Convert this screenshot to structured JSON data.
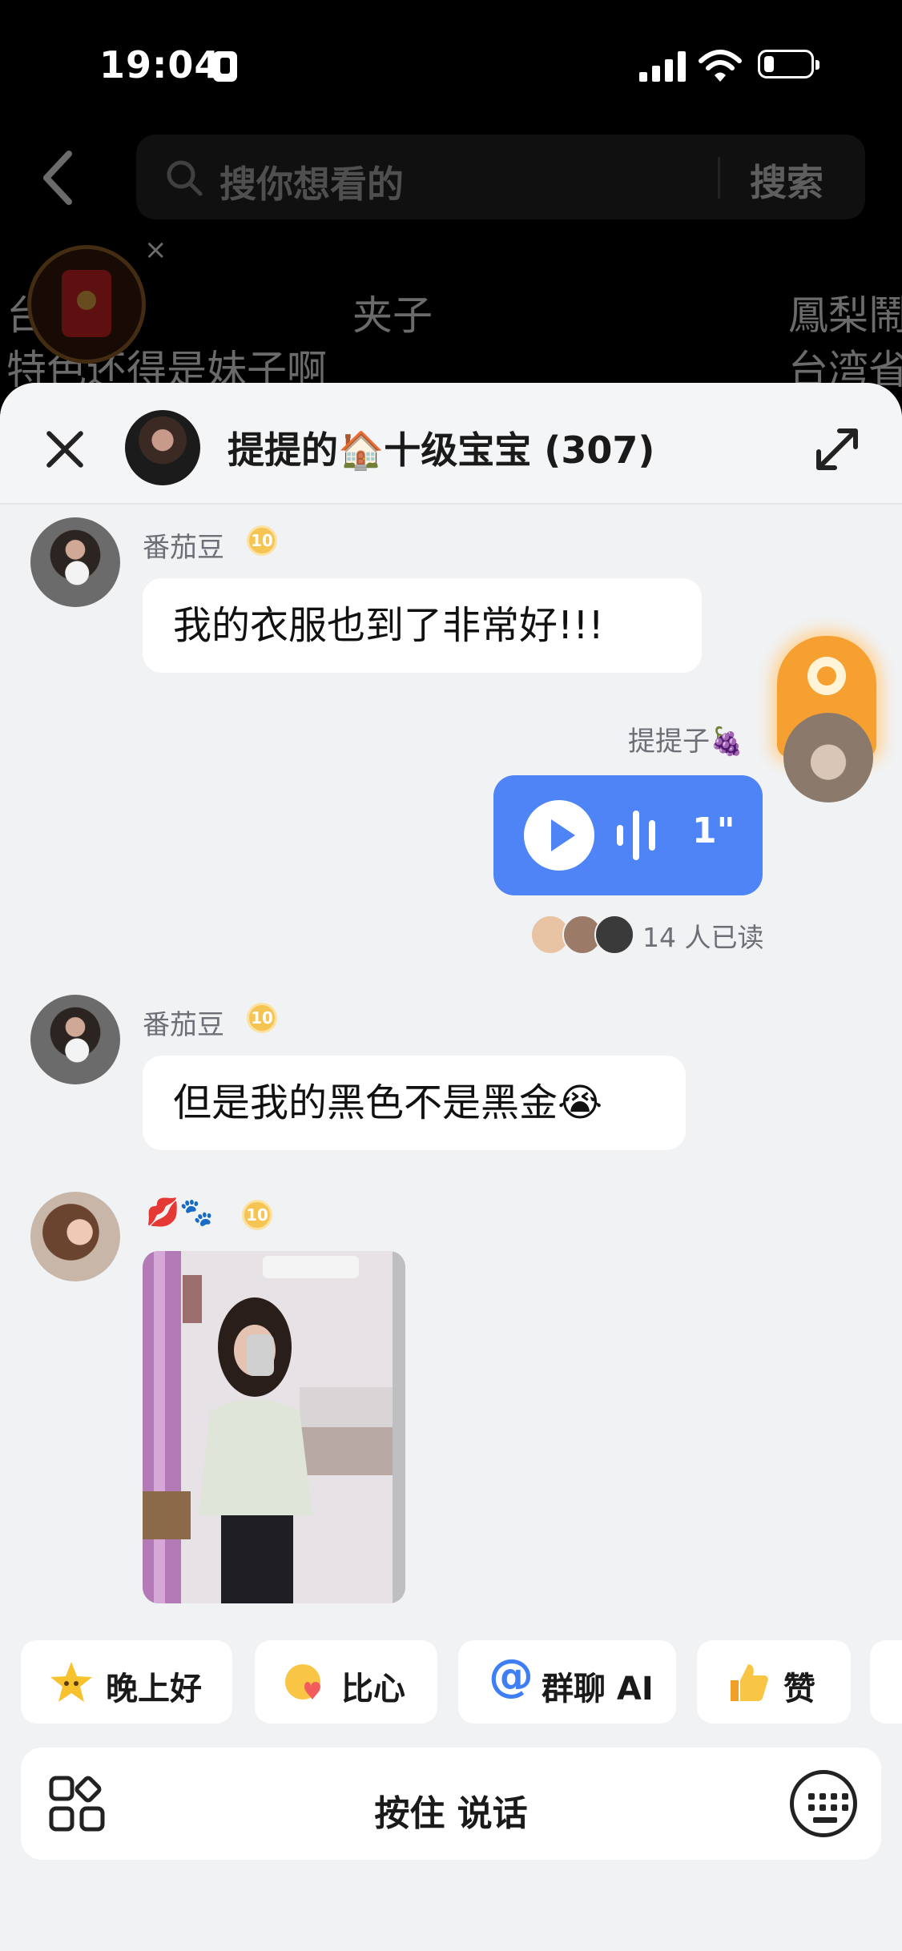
{
  "status": {
    "time": "19:04"
  },
  "background": {
    "search_placeholder": "搜你想看的",
    "search_button": "搜索",
    "topics": [
      "台…省",
      "夹子",
      "鳳梨鬧",
      "特色还得是妹子啊",
      "台湾省"
    ]
  },
  "chat": {
    "title": "提提的🏠十级宝宝 (307)",
    "messages": [
      {
        "sender": "番茄豆",
        "level": "10",
        "text": "我的衣服也到了非常好!!!"
      },
      {
        "sender": "提提子🍇",
        "voice_duration": "1\"",
        "read_count": "14 人已读"
      },
      {
        "sender": "番茄豆",
        "level": "10",
        "text": "但是我的黑色不是黑金😭"
      },
      {
        "sender": "💋🐾",
        "level": "10",
        "type": "image"
      }
    ]
  },
  "quick_replies": [
    "晚上好",
    "比心",
    "群聊 AI",
    "赞"
  ],
  "input": {
    "hold_to_talk": "按住 说话"
  },
  "icons": {
    "close": "close-icon",
    "expand": "expand-icon",
    "play": "play-icon",
    "apps": "apps-grid-icon",
    "keyboard": "keyboard-icon"
  },
  "colors": {
    "voice_bubble": "#4f84f7",
    "sheet_bg": "#f1f2f4",
    "badge": "#f6c453"
  }
}
